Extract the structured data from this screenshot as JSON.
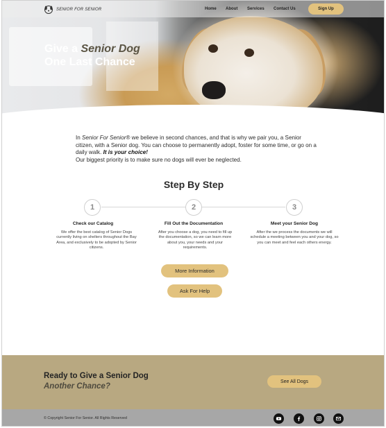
{
  "nav": {
    "logo_text": "SENIOR FOR SENIOR",
    "links": [
      "Home",
      "About",
      "Services",
      "Contact Us"
    ],
    "signup_label": "Sign Up"
  },
  "hero": {
    "title_part1": "Give a ",
    "title_emphasis": "Senior Dog",
    "title_line2": "One Last Chance"
  },
  "intro": {
    "part1": "In ",
    "brand": "Senior For Senior®",
    "part2": " we believe in second chances, and that is why we pair you, a Senior citizen, with a Senior dog. You can choose to permanently adopt, foster for some time, or go on a daily walk. ",
    "emphasis": "It is your choice!",
    "line2": "Our biggest priority is to make sure no dogs will ever be neglected."
  },
  "steps": {
    "title": "Step By Step",
    "items": [
      {
        "number": "1",
        "title": "Check our Catalog",
        "desc": "We offer the best catalog of Senior Dogs currently living on shelters throughout the Bay Area, and exclusively to be adopted by Senior citizens."
      },
      {
        "number": "2",
        "title": "Fill Out the Documentation",
        "desc": "After you choose a dog, you need to fill up the documentation, so we can learn more about you, your needs and your requirements."
      },
      {
        "number": "3",
        "title": "Meet your Senior Dog",
        "desc": "After the we process the documents we will schedule a meeting between you and your dog, so you can meet and feel each others energy."
      }
    ],
    "more_info_label": "More Information",
    "help_label": "Ask For Help"
  },
  "cta": {
    "line1": "Ready to Give a Senior Dog",
    "line2": "Another Chance?",
    "button_label": "See All Dogs"
  },
  "footer": {
    "copyright": "© Copyright Senior For Senior. All Rights Reserved",
    "social_icons": [
      "youtube-icon",
      "facebook-icon",
      "instagram-icon",
      "email-icon"
    ]
  },
  "colors": {
    "accent": "#e2c27e",
    "cta_band": "#b8a881",
    "footer": "#a7a7a7",
    "hero_emphasis": "#5a5443"
  }
}
